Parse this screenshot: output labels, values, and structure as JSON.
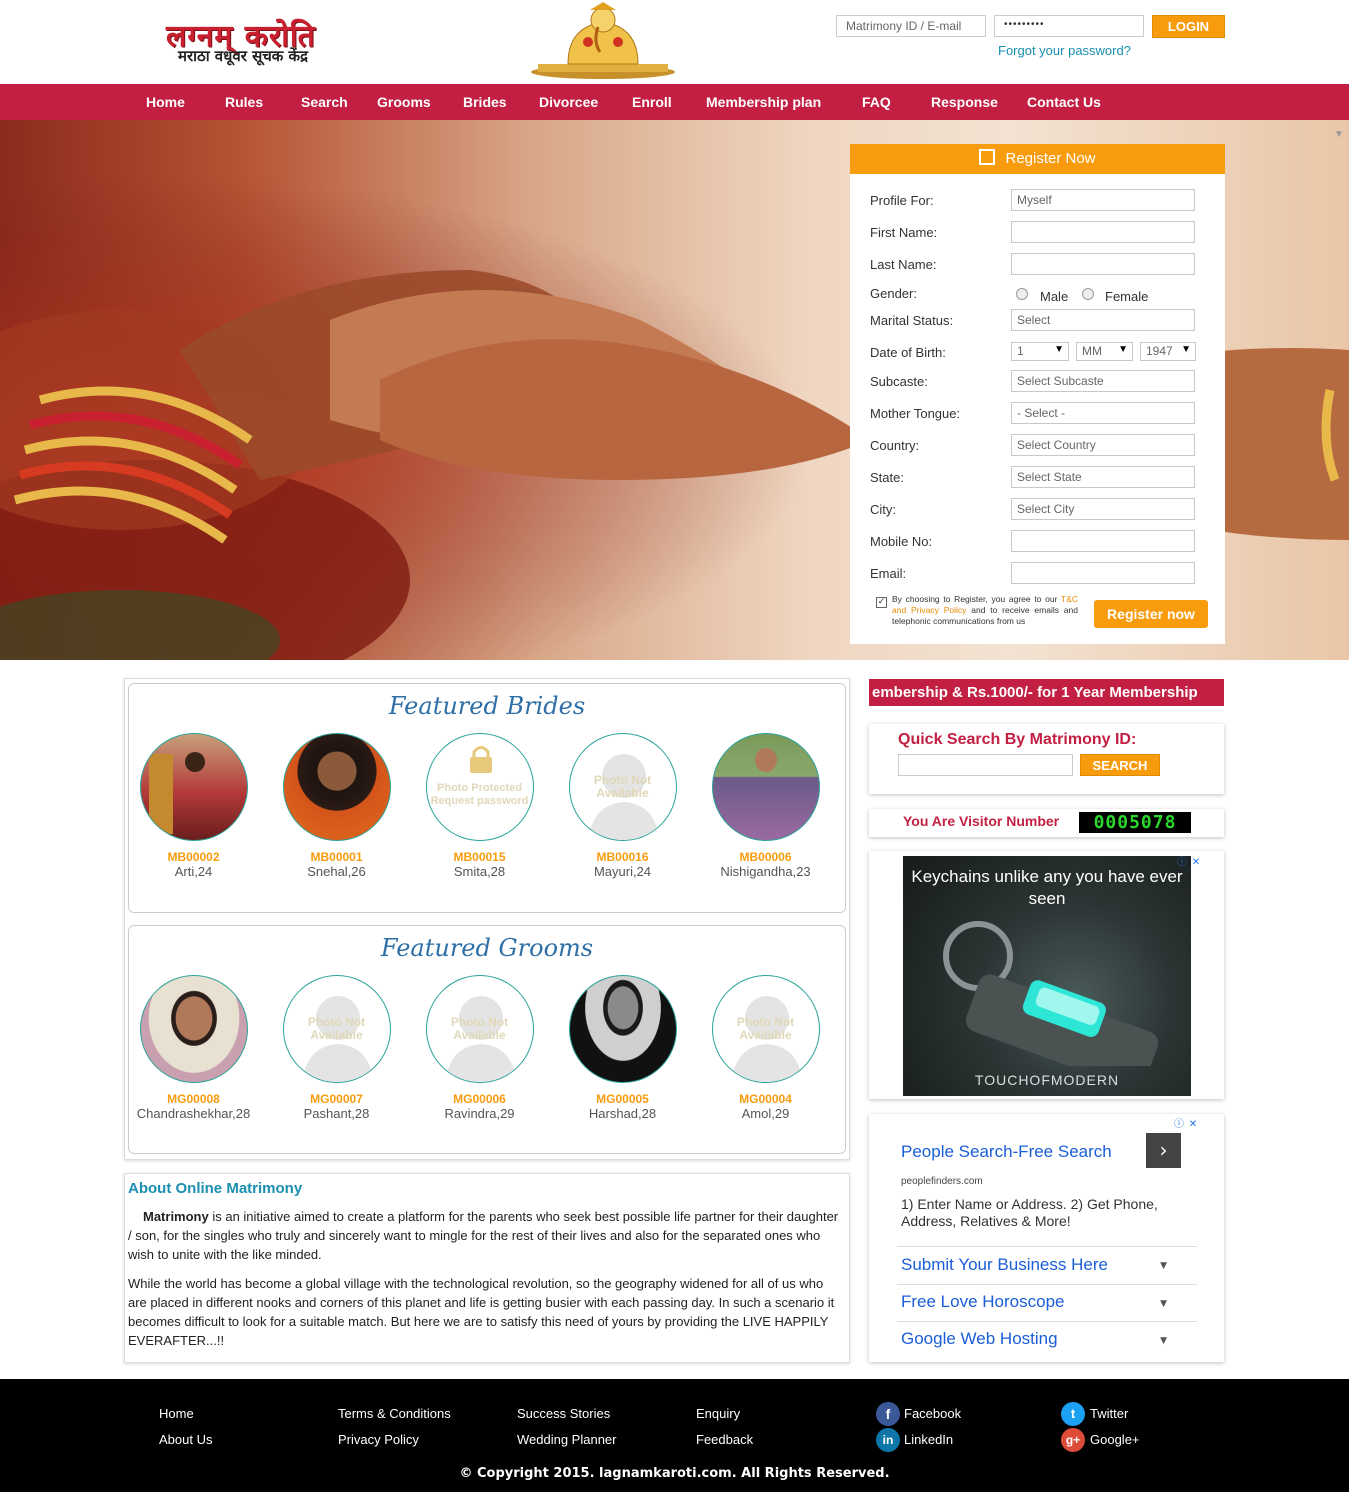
{
  "header": {
    "logo_title": "लग्नम् करोति",
    "logo_subtitle": "मराठा वधूवर सूचक केंद्र",
    "login_placeholder_id": "Matrimony ID / E-mail",
    "login_password_mask": "•••••••••",
    "login_button": "LOGIN",
    "forgot_password": "Forgot your password?"
  },
  "nav": {
    "items": [
      {
        "label": "Home"
      },
      {
        "label": "Rules"
      },
      {
        "label": "Search"
      },
      {
        "label": "Grooms"
      },
      {
        "label": "Brides"
      },
      {
        "label": "Divorcee"
      },
      {
        "label": "Enroll"
      },
      {
        "label": "Membership plan"
      },
      {
        "label": "FAQ"
      },
      {
        "label": "Response"
      },
      {
        "label": "Contact Us"
      }
    ]
  },
  "register": {
    "title": "Register Now",
    "labels": {
      "profile_for": "Profile For:",
      "first_name": "First Name:",
      "last_name": "Last Name:",
      "gender": "Gender:",
      "marital_status": "Marital Status:",
      "dob": "Date of Birth:",
      "subcaste": "Subcaste:",
      "mother_tongue": "Mother Tongue:",
      "country": "Country:",
      "state": "State:",
      "city": "City:",
      "mobile": "Mobile No:",
      "email": "Email:"
    },
    "values": {
      "profile_for": "Myself",
      "marital_status": "Select",
      "dob_day": "1",
      "dob_month": "MM",
      "dob_year": "1947",
      "subcaste": "Select Subcaste",
      "mother_tongue": "- Select -",
      "country": "Select Country",
      "state": "Select State",
      "city": "Select City"
    },
    "gender_male": "Male",
    "gender_female": "Female",
    "terms_pre": "By choosing to Register, you agree to our",
    "terms_link": "T&C and Privacy Policy",
    "terms_post": "and to receive emails and telephonic communications from us",
    "button": "Register now"
  },
  "featured_brides": {
    "title": "Featured Brides",
    "profiles": [
      {
        "id": "MB00002",
        "name": "Arti,24",
        "photo": "photo"
      },
      {
        "id": "MB00001",
        "name": "Snehal,26",
        "photo": "photo"
      },
      {
        "id": "MB00015",
        "name": "Smita,28",
        "photo": "protected",
        "overlay": "Photo Protected Request password"
      },
      {
        "id": "MB00016",
        "name": "Mayuri,24",
        "photo": "na",
        "overlay": "Photo Not Available"
      },
      {
        "id": "MB00006",
        "name": "Nishigandha,23",
        "photo": "photo"
      }
    ]
  },
  "featured_grooms": {
    "title": "Featured Grooms",
    "profiles": [
      {
        "id": "MG00008",
        "name": "Chandrashekhar,28",
        "photo": "photo"
      },
      {
        "id": "MG00007",
        "name": "Pashant,28",
        "photo": "na",
        "overlay": "Photo Not Available"
      },
      {
        "id": "MG00006",
        "name": "Ravindra,29",
        "photo": "na",
        "overlay": "Photo Not Available"
      },
      {
        "id": "MG00005",
        "name": "Harshad,28",
        "photo": "photo"
      },
      {
        "id": "MG00004",
        "name": "Amol,29",
        "photo": "na",
        "overlay": "Photo Not Available"
      }
    ]
  },
  "about": {
    "title": "About Online Matrimony",
    "p1_bold": "Matrimony",
    "p1_rest": " is an initiative aimed to create a platform for the parents who seek best possible life partner for their daughter / son, for the singles who truly and sincerely want to mingle for the rest of their lives and also for the separated ones who wish to unite with the like minded.",
    "p2": "While the world has become a global village with the technological revolution, so the geography widened for all of us who are placed in different nooks and corners of this planet and life is getting busier with each passing day. In such a scenario it becomes difficult to look for a suitable match. But here we are to satisfy this need of yours by providing the LIVE HAPPILY EVERAFTER...!!"
  },
  "sidebar": {
    "marquee": "embership & Rs.1000/- for 1 Year Membership",
    "quick_search_title": "Quick Search By Matrimony ID:",
    "quick_search_button": "SEARCH",
    "visitor_label": "You Are Visitor Number",
    "visitor_count": "0005078"
  },
  "ads": {
    "ad1_headline": "Keychains unlike any you have ever seen",
    "ad1_brand": "TOUCHOFMODERN",
    "ad2_title": "People Search-Free Search",
    "ad2_domain": "peoplefinders.com",
    "ad2_desc": "1) Enter Name or Address. 2) Get Phone, Address, Relatives & More!",
    "ad2_links": [
      {
        "label": "Submit Your Business Here"
      },
      {
        "label": "Free Love Horoscope"
      },
      {
        "label": "Google Web Hosting"
      }
    ]
  },
  "footer": {
    "col1": [
      "Home",
      "About Us"
    ],
    "col2": [
      "Terms & Conditions",
      "Privacy Policy"
    ],
    "col3": [
      "Success Stories",
      "Wedding Planner"
    ],
    "col4": [
      "Enquiry",
      "Feedback"
    ],
    "social": {
      "facebook": "Facebook",
      "linkedin": "LinkedIn",
      "twitter": "Twitter",
      "googleplus": "Google+"
    },
    "copyright": "© Copyright 2015. lagnamkaroti.com. All Rights Reserved."
  },
  "colors": {
    "brand_red": "#c21f43",
    "accent_orange": "#f89c0e",
    "link_blue": "#1a8fb0"
  }
}
